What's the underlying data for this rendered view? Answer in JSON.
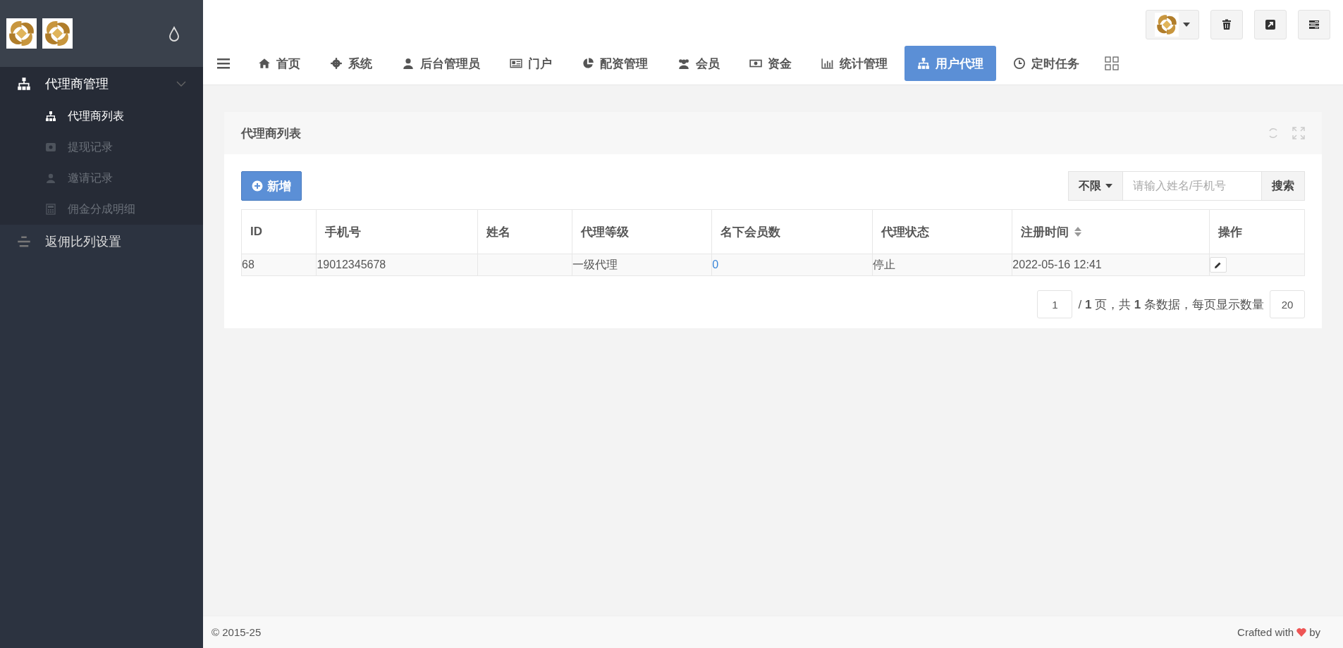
{
  "sidebar": {
    "menu": [
      {
        "label": "代理商管理",
        "expanded": true,
        "children": [
          {
            "label": "代理商列表",
            "selected": true
          },
          {
            "label": "提现记录",
            "selected": false
          },
          {
            "label": "邀请记录",
            "selected": false
          },
          {
            "label": "佣金分成明细",
            "selected": false
          }
        ]
      },
      {
        "label": "返佣比列设置",
        "expanded": false
      }
    ]
  },
  "nav_tabs": [
    {
      "label": "首页",
      "selected": false
    },
    {
      "label": "系统",
      "selected": false
    },
    {
      "label": "后台管理员",
      "selected": false
    },
    {
      "label": "门户",
      "selected": false
    },
    {
      "label": "配资管理",
      "selected": false
    },
    {
      "label": "会员",
      "selected": false
    },
    {
      "label": "资金",
      "selected": false
    },
    {
      "label": "统计管理",
      "selected": false
    },
    {
      "label": "用户代理",
      "selected": true
    },
    {
      "label": "定时任务",
      "selected": false
    }
  ],
  "panel": {
    "title": "代理商列表",
    "add_button": "新增",
    "filter": "不限",
    "search": {
      "placeholder": "请输入姓名/手机号"
    },
    "search_button": "搜索",
    "table": {
      "columns": [
        {
          "label": "ID",
          "sortable": false
        },
        {
          "label": "手机号",
          "sortable": false
        },
        {
          "label": "姓名",
          "sortable": false
        },
        {
          "label": "代理等级",
          "sortable": false
        },
        {
          "label": "名下会员数",
          "sortable": false
        },
        {
          "label": "代理状态",
          "sortable": false
        },
        {
          "label": "注册时间",
          "sortable": true
        },
        {
          "label": "操作",
          "sortable": false
        }
      ],
      "rows": [
        {
          "cells": [
            "68",
            "19012345678",
            "",
            "一级代理",
            "0",
            "停止",
            "2022-05-16 12:41"
          ]
        }
      ]
    },
    "pagination": {
      "page": "1",
      "summary": "/ **1** 页，共 **1** 条数据，每页显示数量",
      "page_size": "20"
    }
  },
  "footer": {
    "copyright": "© 2015-25",
    "credit": "Crafted with",
    "credit_end": "by"
  }
}
